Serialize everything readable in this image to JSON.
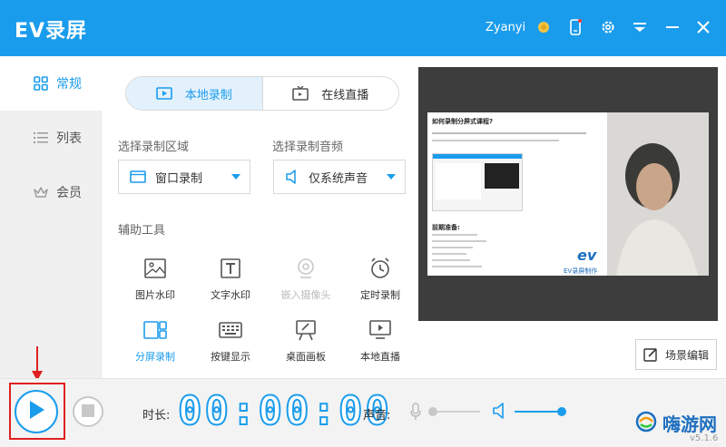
{
  "titlebar": {
    "app_title": "EV录屏",
    "username": "Zyanyi",
    "icons": [
      "medal-icon",
      "phone-icon",
      "gear-icon",
      "menu-icon",
      "minimize-icon",
      "close-icon"
    ]
  },
  "sidebar": {
    "items": [
      {
        "label": "常规",
        "icon": "grid-icon",
        "active": true
      },
      {
        "label": "列表",
        "icon": "list-icon",
        "active": false
      },
      {
        "label": "会员",
        "icon": "crown-icon",
        "active": false
      }
    ]
  },
  "mode_tabs": [
    {
      "label": "本地录制",
      "icon": "video-icon",
      "active": true
    },
    {
      "label": "在线直播",
      "icon": "tv-icon",
      "active": false
    }
  ],
  "record_area": {
    "label": "选择录制区域",
    "value": "窗口录制"
  },
  "record_audio": {
    "label": "选择录制音频",
    "value": "仅系统声音"
  },
  "tools": {
    "label": "辅助工具",
    "items": [
      {
        "label": "图片水印",
        "icon": "image-icon"
      },
      {
        "label": "文字水印",
        "icon": "text-icon"
      },
      {
        "label": "嵌入摄像头",
        "icon": "webcam-icon",
        "disabled": true
      },
      {
        "label": "定时录制",
        "icon": "alarm-icon"
      },
      {
        "label": "分屏录制",
        "icon": "split-screen-icon",
        "highlight": true
      },
      {
        "label": "按键显示",
        "icon": "keyboard-icon"
      },
      {
        "label": "桌面画板",
        "icon": "easel-icon"
      },
      {
        "label": "本地直播",
        "icon": "monitor-play-icon"
      }
    ]
  },
  "preview": {
    "doc_title": "如何录制分屏式课程?",
    "doc_heading": "前期准备:",
    "brand_mark": "ev",
    "brand_caption": "EV录屏制作"
  },
  "scene_button": "场景编辑",
  "bottom": {
    "duration_label": "时长:",
    "timer": "00:00:00",
    "sound_label": "声音:",
    "mic_level": 0.0,
    "speaker_level": 1.0
  },
  "watermark": "嗨游网",
  "version": "v5.1.6",
  "colors": {
    "accent": "#1a9cec",
    "highlight_box": "#e02020"
  }
}
